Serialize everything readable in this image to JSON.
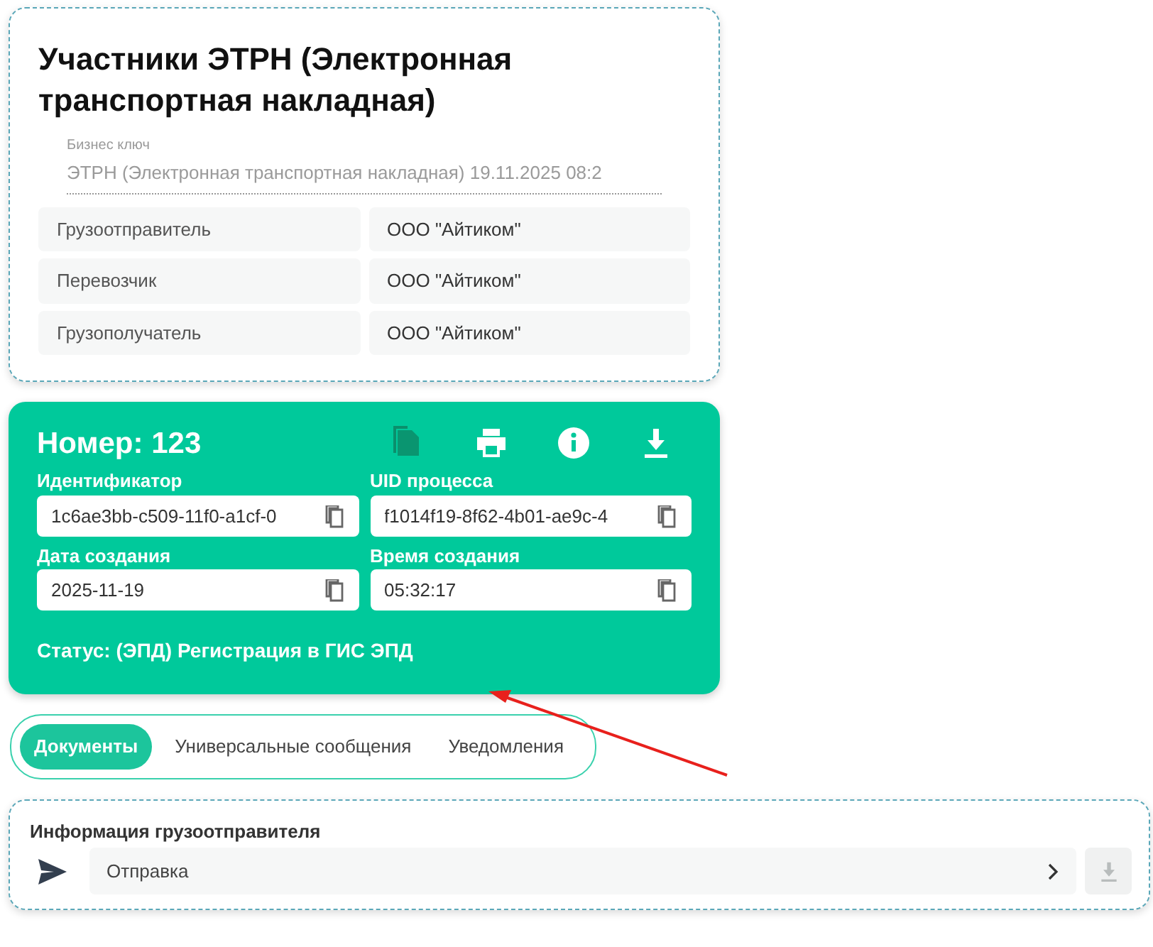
{
  "participants_card": {
    "title": "Участники ЭТРН (Электронная транспортная накладная)",
    "business_key": {
      "label": "Бизнес ключ",
      "value": "ЭТРН (Электронная транспортная накладная) 19.11.2025 08:2"
    },
    "rows": [
      {
        "role": "Грузоотправитель",
        "org": "ООО \"Айтиком\""
      },
      {
        "role": "Перевозчик",
        "org": "ООО \"Айтиком\""
      },
      {
        "role": "Грузополучатель",
        "org": "ООО \"Айтиком\""
      }
    ]
  },
  "document_card": {
    "number": "Номер: 123",
    "actions": [
      {
        "kind": "copy",
        "disabled": true
      },
      {
        "kind": "print",
        "disabled": false
      },
      {
        "kind": "info",
        "disabled": false
      },
      {
        "kind": "download",
        "disabled": false
      }
    ],
    "fields": [
      {
        "label": "Идентификатор",
        "value": "1c6ae3bb-c509-11f0-a1cf-0"
      },
      {
        "label": "UID процесса",
        "value": "f1014f19-8f62-4b01-ae9c-4"
      },
      {
        "label": "Дата создания",
        "value": "2025-11-19"
      },
      {
        "label": "Время создания",
        "value": "05:32:17"
      }
    ],
    "status": "Статус: (ЭПД) Регистрация в ГИС ЭПД"
  },
  "tabs": [
    {
      "label": "Документы",
      "selected": true
    },
    {
      "label": "Универсальные сообщения",
      "selected": false
    },
    {
      "label": "Уведомления",
      "selected": false
    }
  ],
  "sender_section": {
    "title": "Информация грузоотправителя",
    "item": {
      "label": "Отправка"
    },
    "download_disabled": true
  }
}
